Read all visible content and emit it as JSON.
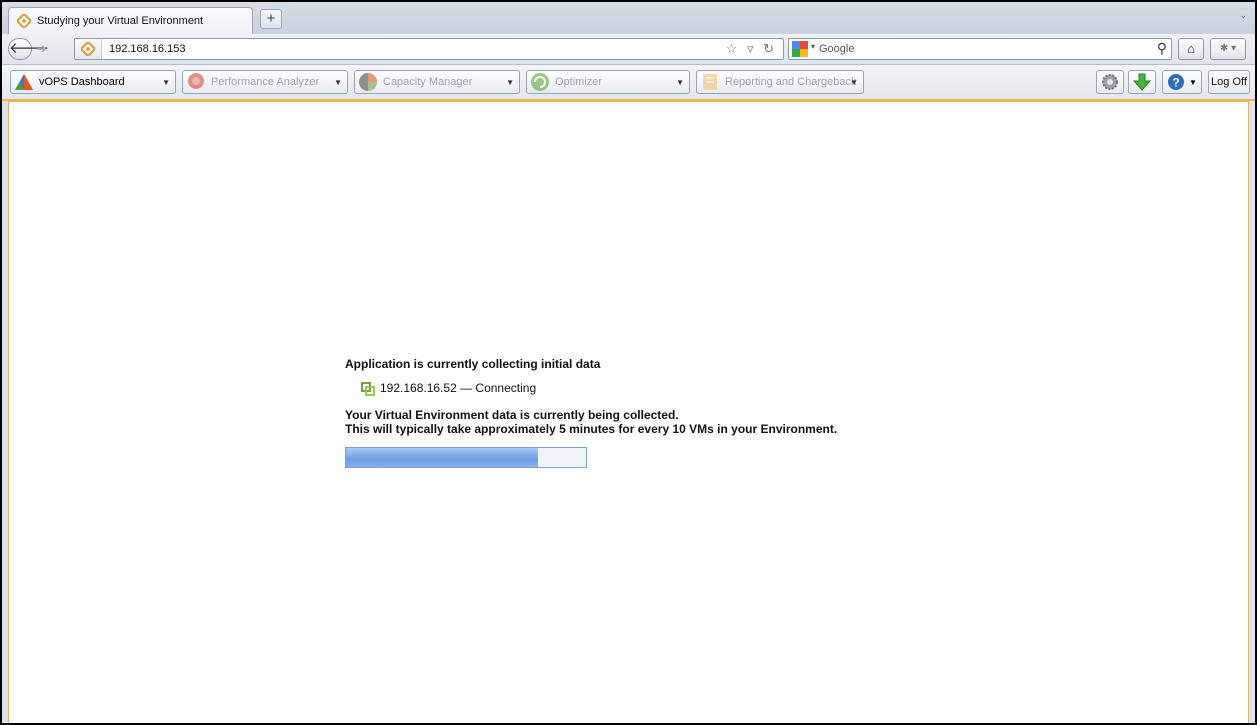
{
  "browser": {
    "tab_title": "Studying your Virtual Environment",
    "new_tab_label": "+",
    "address": "192.168.16.153",
    "search_placeholder": "Google",
    "search_engine_icon": "google-icon",
    "home_icon": "home-icon"
  },
  "toolbar": {
    "items": [
      {
        "label": "vOPS Dashboard",
        "icon": "vops-triangle-icon",
        "enabled": true
      },
      {
        "label": "Performance Analyzer",
        "icon": "performance-analyzer-icon",
        "enabled": false
      },
      {
        "label": "Capacity Manager",
        "icon": "capacity-manager-icon",
        "enabled": false
      },
      {
        "label": "Optimizer",
        "icon": "optimizer-icon",
        "enabled": false
      },
      {
        "label": "Reporting and Chargeback",
        "icon": "reporting-icon",
        "enabled": false
      }
    ],
    "log_off_label": "Log Off",
    "settings_icon": "gear-icon",
    "download_icon": "green-down-arrow-icon",
    "help_icon": "help-icon"
  },
  "status": {
    "headline": "Application is currently collecting initial data",
    "host": "192.168.16.52 — Connecting",
    "line1": "Your Virtual Environment data is currently being collected.",
    "line2": "This will typically take approximately 5 minutes for every 10 VMs in your Environment.",
    "progress_percent": 80
  },
  "colors": {
    "accent_orange": "#e8b45a",
    "progress_blue": "#6b9fe4"
  }
}
